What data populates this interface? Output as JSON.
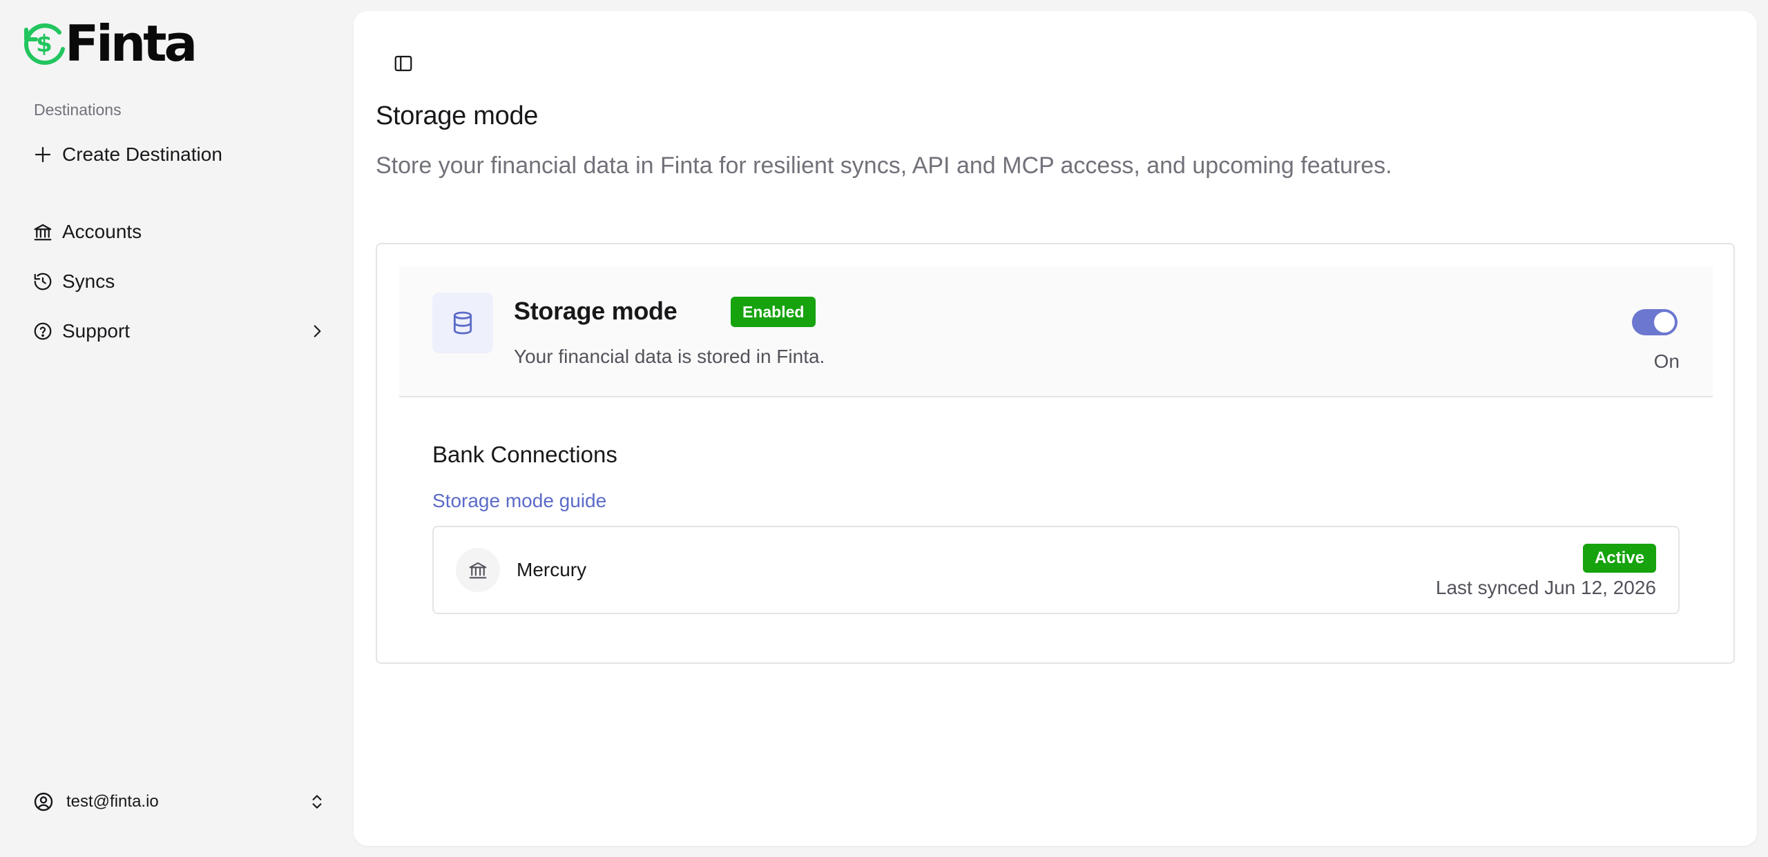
{
  "app": {
    "logo_text": "Finta"
  },
  "colors": {
    "accent": "#6c77cf",
    "success": "#16a30e",
    "brand_green": "#22c55e",
    "link": "#5b6bc8"
  },
  "sidebar": {
    "section_label": "Destinations",
    "items": [
      {
        "label": "Create Destination",
        "icon": "plus-icon"
      },
      {
        "label": "Accounts",
        "icon": "bank-icon"
      },
      {
        "label": "Syncs",
        "icon": "history-icon"
      },
      {
        "label": "Support",
        "icon": "help-circle-icon"
      }
    ],
    "user": {
      "email": "test@finta.io"
    }
  },
  "main": {
    "title": "Storage mode",
    "subtitle": "Store your financial data in Finta for resilient syncs, API and MCP access, and upcoming features.",
    "card": {
      "title": "Storage mode",
      "badge": "Enabled",
      "description": "Your financial data is stored in Finta.",
      "toggle": {
        "on": true,
        "label": "On"
      },
      "connections": {
        "title": "Bank Connections",
        "guide_link": "Storage mode guide",
        "items": [
          {
            "name": "Mercury",
            "status": "Active",
            "last_synced": "Last synced Jun 12, 2026"
          }
        ]
      }
    }
  }
}
